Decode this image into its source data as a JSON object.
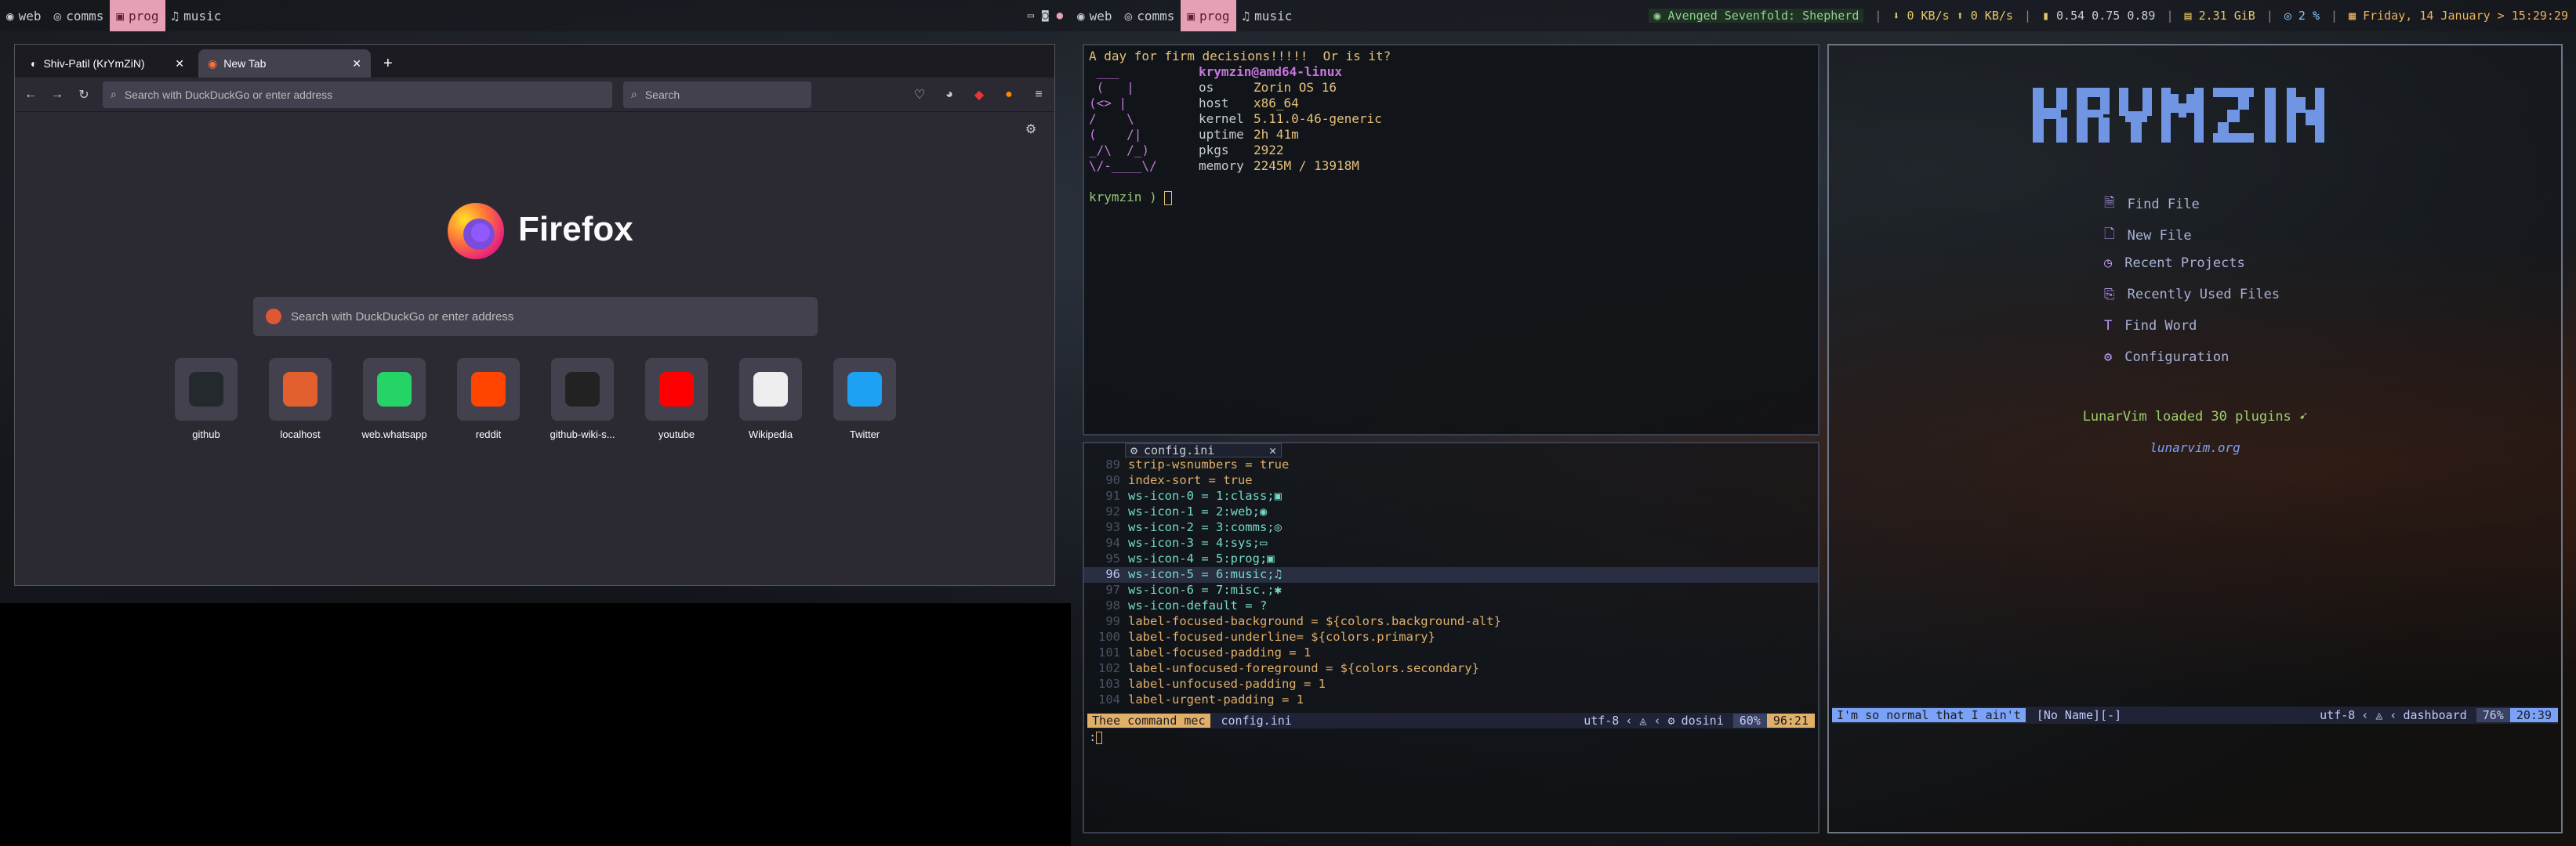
{
  "left_bar": {
    "workspaces": [
      {
        "icon": "◉",
        "label": "web"
      },
      {
        "icon": "◎",
        "label": "comms"
      },
      {
        "icon": "▣",
        "label": "prog"
      },
      {
        "icon": "♫",
        "label": "music"
      }
    ],
    "active": 2
  },
  "right_bar": {
    "workspaces": [
      {
        "icon": "◉",
        "label": "web"
      },
      {
        "icon": "◎",
        "label": "comms"
      },
      {
        "icon": "▣",
        "label": "prog"
      },
      {
        "icon": "♫",
        "label": "music"
      }
    ],
    "active": 2,
    "now_playing": "Avenged Sevenfold: Shepherd",
    "net_down": "0 KB/s",
    "net_up": "0 KB/s",
    "load": "0.54 0.75 0.89",
    "mem": "2.31 GiB",
    "cpu": "2 %",
    "datetime": "Friday, 14 January > 15:29:29"
  },
  "firefox": {
    "tabs": [
      {
        "title": "Shiv-Patil (KrYmZiN)"
      },
      {
        "title": "New Tab"
      }
    ],
    "url_placeholder": "Search with DuckDuckGo or enter address",
    "search_placeholder": "Search",
    "brand": "Firefox",
    "home_search_placeholder": "Search with DuckDuckGo or enter address",
    "shortcuts": [
      {
        "label": "github",
        "color": "#24292e"
      },
      {
        "label": "localhost",
        "color": "#e1602e"
      },
      {
        "label": "web.whatsapp",
        "color": "#25d366"
      },
      {
        "label": "reddit",
        "color": "#ff4500"
      },
      {
        "label": "github-wiki-s...",
        "color": "#222222"
      },
      {
        "label": "youtube",
        "color": "#ff0000"
      },
      {
        "label": "Wikipedia",
        "color": "#eeeeee"
      },
      {
        "label": "Twitter",
        "color": "#1da1f2"
      }
    ]
  },
  "fetch": {
    "header": "A day for firm decisions!!!!!  Or is it?",
    "user": "krymzin@amd64-linux",
    "art": [
      " ___",
      " (   |",
      "(<> |",
      "/    \\",
      "(    /|",
      "_/\\  /_)",
      "\\/-____\\/"
    ],
    "rows": [
      {
        "k": "os",
        "v": "Zorin OS 16"
      },
      {
        "k": "host",
        "v": "x86_64"
      },
      {
        "k": "kernel",
        "v": "5.11.0-46-generic"
      },
      {
        "k": "uptime",
        "v": "2h 41m"
      },
      {
        "k": "pkgs",
        "v": "2922"
      },
      {
        "k": "memory",
        "v": "2245M / 13918M"
      }
    ],
    "prompt": "krymzin ) "
  },
  "editor": {
    "tab": "config.ini",
    "lines": [
      {
        "n": "89",
        "t": "strip-wsnumbers = true"
      },
      {
        "n": "90",
        "t": "index-sort = true"
      },
      {
        "n": "91",
        "t": "ws-icon-0 = 1:class;▣"
      },
      {
        "n": "92",
        "t": "ws-icon-1 = 2:web;◉"
      },
      {
        "n": "93",
        "t": "ws-icon-2 = 3:comms;◎"
      },
      {
        "n": "94",
        "t": "ws-icon-3 = 4:sys;▭"
      },
      {
        "n": "95",
        "t": "ws-icon-4 = 5:prog;▣"
      },
      {
        "n": "96",
        "t": "ws-icon-5 = 6:music;♫"
      },
      {
        "n": "97",
        "t": "ws-icon-6 = 7:misc.;✱"
      },
      {
        "n": "98",
        "t": "ws-icon-default = ?"
      },
      {
        "n": "99",
        "t": "label-focused-background = ${colors.background-alt}"
      },
      {
        "n": "100",
        "t": "label-focused-underline= ${colors.primary}"
      },
      {
        "n": "101",
        "t": "label-focused-padding = 1"
      },
      {
        "n": "102",
        "t": "label-unfocused-foreground = ${colors.secondary}"
      },
      {
        "n": "103",
        "t": "label-unfocused-padding = 1"
      },
      {
        "n": "104",
        "t": "label-urgent-padding = 1"
      }
    ],
    "current_line": "96",
    "status": {
      "mode": "Thee command mec",
      "file": "config.ini",
      "enc": "utf-8",
      "ft": "dosini",
      "pct": "60%",
      "pos": "96:21"
    },
    "cmdline": ":"
  },
  "dashboard": {
    "logo": "KRYMZIN",
    "items": [
      {
        "icon": "🗎",
        "label": "Find File"
      },
      {
        "icon": "🗋",
        "label": "New File"
      },
      {
        "icon": "◷",
        "label": "Recent Projects"
      },
      {
        "icon": "⎘",
        "label": "Recently Used Files"
      },
      {
        "icon": "T",
        "label": "Find Word"
      },
      {
        "icon": "⚙",
        "label": "Configuration"
      }
    ],
    "loaded": "LunarVim loaded 30 plugins",
    "url": "lunarvim.org",
    "status": {
      "mode": "I'm so normal that I ain't",
      "name": "[No Name][-]",
      "enc": "utf-8",
      "ft": "dashboard",
      "pct": "76%",
      "pos": "20:39"
    }
  }
}
